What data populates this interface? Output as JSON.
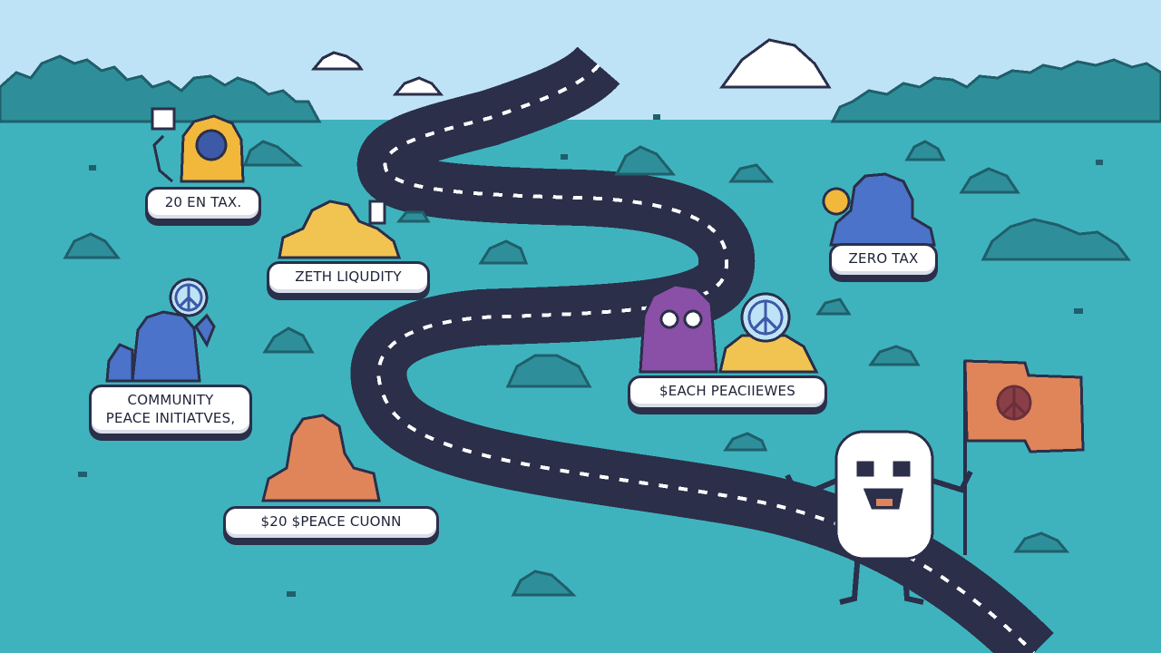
{
  "roadmap": {
    "milestones": [
      {
        "lines": [
          "20 EN TAX."
        ]
      },
      {
        "lines": [
          "ZETH LIQUDITY"
        ]
      },
      {
        "lines": [
          "COMMUNITY",
          "PEACE INITIATVES,"
        ]
      },
      {
        "lines": [
          "$20 $PEACE CUONN"
        ]
      },
      {
        "lines": [
          "ZERO TAX"
        ]
      },
      {
        "lines": [
          "$EACH PEACIIEWES"
        ]
      }
    ]
  },
  "colors": {
    "sky": "#bfe3f6",
    "grass": "#3fb3bd",
    "road": "#2b2f4a",
    "bush": "#2e8f9a",
    "flag": "#e0855a"
  },
  "icons": [
    "peace-sign-icon",
    "flag-icon",
    "bush-icon",
    "cloud-icon"
  ]
}
